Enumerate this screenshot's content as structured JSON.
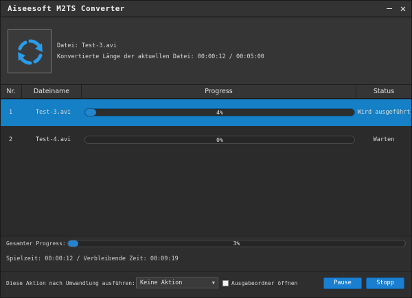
{
  "window": {
    "title": "Aiseesoft M2TS Converter"
  },
  "titlebar": {
    "minimize_glyph": "–",
    "close_glyph": "✕"
  },
  "current": {
    "file_line": "Datei: Test-3.avi",
    "length_line": "Konvertierte Länge der aktuellen Datei: 00:00:12 / 00:05:00",
    "icon": "convert-refresh-icon"
  },
  "table": {
    "headers": {
      "nr": "Nr.",
      "name": "Dateiname",
      "progress": "Progress",
      "status": "Status"
    },
    "rows": [
      {
        "nr": "1",
        "name": "Test-3.avi",
        "progress_label": "4%",
        "progress": 4,
        "status": "Wird ausgeführt",
        "selected": true
      },
      {
        "nr": "2",
        "name": "Test-4.avi",
        "progress_label": "0%",
        "progress": 0,
        "status": "Warten",
        "selected": false
      }
    ]
  },
  "overall": {
    "label": "Gesamter Progress:",
    "progress_label": "3%",
    "progress": 3,
    "times": "Spielzeit: 00:00:12 / Verbleibende Zeit: 00:09:19"
  },
  "after": {
    "label": "Diese Aktion nach Umwandlung ausführen:",
    "selected": "Keine Aktion",
    "checkbox_label": "Ausgabeordner öffnen",
    "checkbox_checked": false
  },
  "buttons": {
    "pause": "Pause",
    "stop": "Stopp"
  },
  "colors": {
    "accent": "#1580c6",
    "button": "#1a7fd0",
    "background": "#2d2d2d"
  }
}
